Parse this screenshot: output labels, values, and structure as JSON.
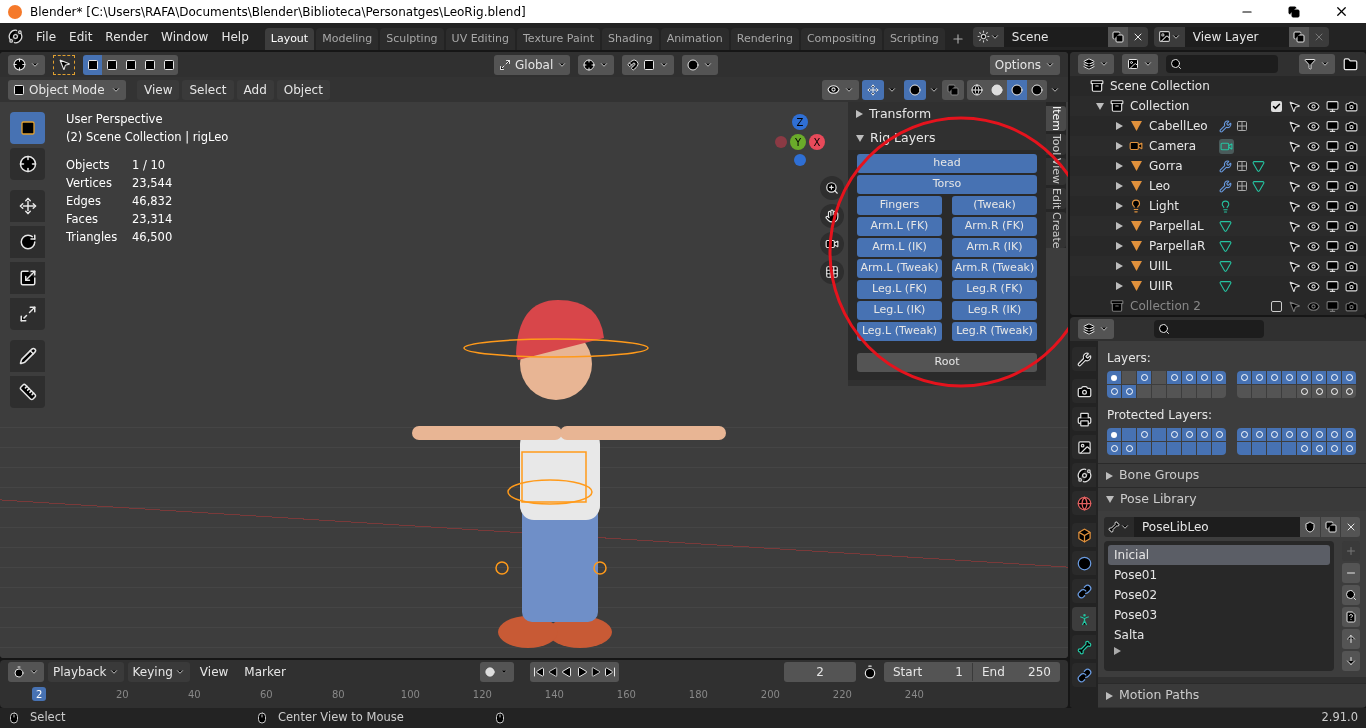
{
  "title_bar": {
    "title": "Blender* [C:\\Users\\RAFA\\Documents\\Blender\\Biblioteca\\Personatges\\LeoRig.blend]"
  },
  "menu": [
    "File",
    "Edit",
    "Render",
    "Window",
    "Help"
  ],
  "workspaces": [
    {
      "label": "Layout",
      "selected": true
    },
    {
      "label": "Modeling",
      "selected": false
    },
    {
      "label": "Sculpting",
      "selected": false
    },
    {
      "label": "UV Editing",
      "selected": false
    },
    {
      "label": "Texture Paint",
      "selected": false
    },
    {
      "label": "Shading",
      "selected": false
    },
    {
      "label": "Animation",
      "selected": false
    },
    {
      "label": "Rendering",
      "selected": false
    },
    {
      "label": "Compositing",
      "selected": false
    },
    {
      "label": "Scripting",
      "selected": false
    }
  ],
  "scene": {
    "name": "Scene"
  },
  "view_layer": {
    "name": "View Layer"
  },
  "tool_header": {
    "orientation": "Global",
    "options": "Options"
  },
  "viewport_header": {
    "mode": "Object Mode",
    "menus": [
      "View",
      "Select",
      "Add",
      "Object"
    ]
  },
  "viewport_info": {
    "view": "User Perspective",
    "context": "(2) Scene Collection | rigLeo",
    "stats": [
      {
        "label": "Objects",
        "value": "1 / 10"
      },
      {
        "label": "Vertices",
        "value": "23,544"
      },
      {
        "label": "Edges",
        "value": "46,832"
      },
      {
        "label": "Faces",
        "value": "23,314"
      },
      {
        "label": "Triangles",
        "value": "46,500"
      }
    ]
  },
  "gizmo": {
    "z": "Z",
    "y": "Y",
    "x": "X"
  },
  "n_panel": {
    "sections": [
      {
        "title": "Transform",
        "expanded": false
      },
      {
        "title": "Rig Layers",
        "expanded": true
      }
    ],
    "rig_layers": [
      [
        {
          "label": "head",
          "on": true
        }
      ],
      [
        {
          "label": "Torso",
          "on": true
        }
      ],
      [
        {
          "label": "Fingers",
          "on": true
        },
        {
          "label": "(Tweak)",
          "on": true
        }
      ],
      [
        {
          "label": "Arm.L (FK)",
          "on": true
        },
        {
          "label": "Arm.R (FK)",
          "on": true
        }
      ],
      [
        {
          "label": "Arm.L (IK)",
          "on": true
        },
        {
          "label": "Arm.R (IK)",
          "on": true
        }
      ],
      [
        {
          "label": "Arm.L (Tweak)",
          "on": true
        },
        {
          "label": "Arm.R (Tweak)",
          "on": true
        }
      ],
      [
        {
          "label": "Leg.L (FK)",
          "on": true
        },
        {
          "label": "Leg.R (FK)",
          "on": true
        }
      ],
      [
        {
          "label": "Leg.L (IK)",
          "on": true
        },
        {
          "label": "Leg.R (IK)",
          "on": true
        }
      ],
      [
        {
          "label": "Leg.L (Tweak)",
          "on": true
        },
        {
          "label": "Leg.R (Tweak)",
          "on": true
        }
      ]
    ],
    "root": {
      "label": "Root",
      "on": false
    },
    "tabs": [
      {
        "label": "Item",
        "selected": true
      },
      {
        "label": "Tool",
        "selected": false
      },
      {
        "label": "View",
        "selected": false
      },
      {
        "label": "Edit",
        "selected": false
      },
      {
        "label": "Create",
        "selected": false
      }
    ]
  },
  "outliner": {
    "root": "Scene Collection",
    "collections": [
      {
        "name": "Collection",
        "checked": true,
        "expanded": true,
        "children": [
          {
            "name": "CabellLeo",
            "kind": "mesh",
            "modifiers": true,
            "vertex_groups": true,
            "data": false
          },
          {
            "name": "Camera",
            "kind": "camera",
            "modifiers": false,
            "vertex_groups": false,
            "data": true
          },
          {
            "name": "Gorra",
            "kind": "mesh",
            "modifiers": true,
            "vertex_groups": true,
            "data": true
          },
          {
            "name": "Leo",
            "kind": "mesh",
            "modifiers": true,
            "vertex_groups": true,
            "data": true
          },
          {
            "name": "Light",
            "kind": "light",
            "modifiers": false,
            "vertex_groups": false,
            "data": true
          },
          {
            "name": "ParpellaL",
            "kind": "mesh",
            "modifiers": false,
            "vertex_groups": false,
            "data": true
          },
          {
            "name": "ParpellaR",
            "kind": "mesh",
            "modifiers": false,
            "vertex_groups": false,
            "data": true
          },
          {
            "name": "UIIL",
            "kind": "mesh",
            "modifiers": false,
            "vertex_groups": false,
            "data": true
          },
          {
            "name": "UIIR",
            "kind": "mesh",
            "modifiers": false,
            "vertex_groups": false,
            "data": true
          }
        ]
      },
      {
        "name": "Collection 2",
        "checked": false,
        "expanded": false
      }
    ]
  },
  "properties": {
    "tabs": [
      {
        "kind": "tool",
        "selected": false
      },
      {
        "kind": "render",
        "selected": false
      },
      {
        "kind": "output",
        "selected": false
      },
      {
        "kind": "view_layer",
        "selected": false
      },
      {
        "kind": "scene",
        "selected": false
      },
      {
        "kind": "world",
        "selected": false
      },
      {
        "kind": "object",
        "selected": false
      },
      {
        "kind": "physics",
        "selected": false
      },
      {
        "kind": "constraints",
        "selected": false
      },
      {
        "kind": "armature",
        "selected": true
      },
      {
        "kind": "bone",
        "selected": false
      },
      {
        "kind": "bone_constraints",
        "selected": false
      }
    ],
    "layers": {
      "label": "Layers:",
      "blocks": [
        [
          [
            {
              "on": true,
              "bones": true,
              "active": true
            },
            {
              "on": false,
              "bones": false,
              "active": false
            },
            {
              "on": true,
              "bones": true,
              "active": false
            },
            {
              "on": false,
              "bones": false,
              "active": false
            },
            {
              "on": true,
              "bones": true,
              "active": false
            },
            {
              "on": true,
              "bones": true,
              "active": false
            },
            {
              "on": true,
              "bones": true,
              "active": false
            },
            {
              "on": true,
              "bones": true,
              "active": false
            }
          ],
          [
            {
              "on": true,
              "bones": true,
              "active": false
            },
            {
              "on": true,
              "bones": true,
              "active": false
            },
            {
              "on": false,
              "bones": false,
              "active": false
            },
            {
              "on": false,
              "bones": false,
              "active": false
            },
            {
              "on": false,
              "bones": false,
              "active": false
            },
            {
              "on": false,
              "bones": false,
              "active": false
            },
            {
              "on": false,
              "bones": false,
              "active": false
            },
            {
              "on": false,
              "bones": false,
              "active": false
            }
          ]
        ],
        [
          [
            {
              "on": true,
              "bones": true,
              "active": false
            },
            {
              "on": true,
              "bones": true,
              "active": false
            },
            {
              "on": true,
              "bones": true,
              "active": false
            },
            {
              "on": true,
              "bones": true,
              "active": false
            },
            {
              "on": true,
              "bones": true,
              "active": false
            },
            {
              "on": true,
              "bones": true,
              "active": false
            },
            {
              "on": true,
              "bones": true,
              "active": false
            },
            {
              "on": true,
              "bones": true,
              "active": false
            }
          ],
          [
            {
              "on": false,
              "bones": false,
              "active": false
            },
            {
              "on": false,
              "bones": false,
              "active": false
            },
            {
              "on": false,
              "bones": false,
              "active": false
            },
            {
              "on": false,
              "bones": false,
              "active": false
            },
            {
              "on": false,
              "bones": true,
              "active": false
            },
            {
              "on": false,
              "bones": true,
              "active": false
            },
            {
              "on": false,
              "bones": true,
              "active": false
            },
            {
              "on": false,
              "bones": true,
              "active": false
            }
          ]
        ]
      ]
    },
    "protected_layers": {
      "label": "Protected Layers:",
      "blocks": [
        [
          [
            {
              "on": true,
              "bones": true,
              "active": true
            },
            {
              "on": true,
              "bones": false,
              "active": false
            },
            {
              "on": true,
              "bones": true,
              "active": false
            },
            {
              "on": true,
              "bones": false,
              "active": false
            },
            {
              "on": true,
              "bones": true,
              "active": false
            },
            {
              "on": true,
              "bones": true,
              "active": false
            },
            {
              "on": true,
              "bones": true,
              "active": false
            },
            {
              "on": true,
              "bones": true,
              "active": false
            }
          ],
          [
            {
              "on": true,
              "bones": true,
              "active": false
            },
            {
              "on": true,
              "bones": true,
              "active": false
            },
            {
              "on": true,
              "bones": false,
              "active": false
            },
            {
              "on": true,
              "bones": false,
              "active": false
            },
            {
              "on": true,
              "bones": false,
              "active": false
            },
            {
              "on": true,
              "bones": false,
              "active": false
            },
            {
              "on": true,
              "bones": false,
              "active": false
            },
            {
              "on": true,
              "bones": false,
              "active": false
            }
          ]
        ],
        [
          [
            {
              "on": true,
              "bones": true,
              "active": false
            },
            {
              "on": true,
              "bones": true,
              "active": false
            },
            {
              "on": true,
              "bones": true,
              "active": false
            },
            {
              "on": true,
              "bones": true,
              "active": false
            },
            {
              "on": true,
              "bones": true,
              "active": false
            },
            {
              "on": true,
              "bones": true,
              "active": false
            },
            {
              "on": true,
              "bones": true,
              "active": false
            },
            {
              "on": true,
              "bones": true,
              "active": false
            }
          ],
          [
            {
              "on": true,
              "bones": false,
              "active": false
            },
            {
              "on": true,
              "bones": false,
              "active": false
            },
            {
              "on": true,
              "bones": false,
              "active": false
            },
            {
              "on": true,
              "bones": false,
              "active": false
            },
            {
              "on": true,
              "bones": true,
              "active": false
            },
            {
              "on": true,
              "bones": true,
              "active": false
            },
            {
              "on": true,
              "bones": true,
              "active": false
            },
            {
              "on": true,
              "bones": true,
              "active": false
            }
          ]
        ]
      ]
    },
    "panels": [
      {
        "title": "Bone Groups",
        "expanded": false
      },
      {
        "title": "Pose Library",
        "expanded": true
      }
    ],
    "pose_library": {
      "name": "PoseLibLeo",
      "poses": [
        {
          "name": "Inicial",
          "selected": true
        },
        {
          "name": "Pose01",
          "selected": false
        },
        {
          "name": "Pose02",
          "selected": false
        },
        {
          "name": "Pose03",
          "selected": false
        },
        {
          "name": "Salta",
          "selected": false
        }
      ]
    },
    "bottom_panels": [
      {
        "title": "Motion Paths",
        "expanded": false
      }
    ]
  },
  "timeline": {
    "menus": [
      "Playback",
      "Keying",
      "View",
      "Marker"
    ],
    "current_frame": "2",
    "start_label": "Start",
    "start": "1",
    "end_label": "End",
    "end": "250",
    "playhead": "2",
    "ruler": [
      "20",
      "40",
      "60",
      "80",
      "100",
      "120",
      "140",
      "160",
      "180",
      "200",
      "220",
      "240"
    ]
  },
  "status_bar": {
    "items": [
      "Select",
      "Center View to Mouse"
    ],
    "version": "2.91.0"
  }
}
